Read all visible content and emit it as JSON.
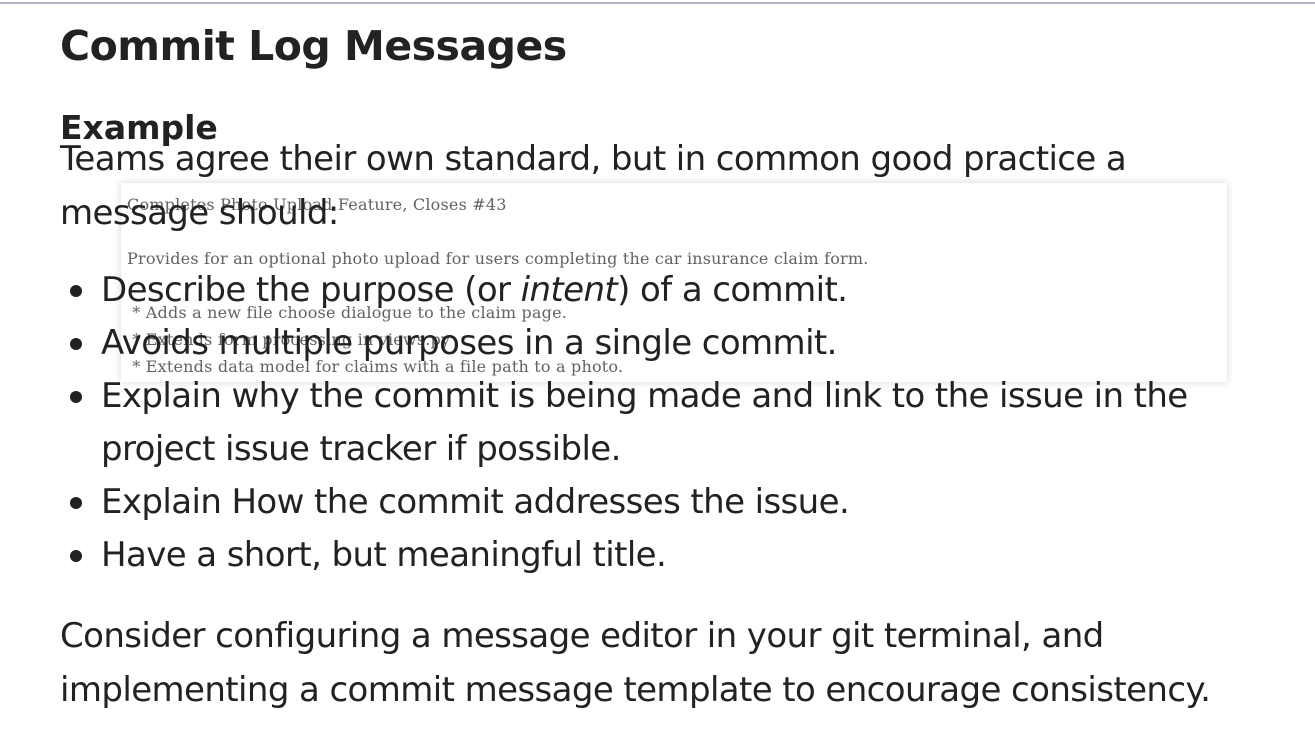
{
  "title": "Commit Log Messages",
  "example_heading": "Example",
  "intro": "Teams agree their own standard, but in common good practice a message should:",
  "code_sample": {
    "line1": "Completes Photo Upload Feature, Closes #43",
    "line2": "",
    "line3": "Provides for an optional photo upload for users completing the car insurance claim form.",
    "line4": "",
    "line5": " * Adds a new file choose dialogue to the claim page.",
    "line6": " * Extends form processing in views.py",
    "line7": " * Extends data model for claims with a file path to a photo."
  },
  "points": [
    {
      "before": "Describe the purpose (or ",
      "em": "intent",
      "after": ") of a commit."
    },
    {
      "before": "Avoids multiple purposes in a single commit.",
      "em": "",
      "after": ""
    },
    {
      "before": "Explain why the commit is being made and link to the issue in the project issue tracker if possible.",
      "em": "",
      "after": ""
    },
    {
      "before": "Explain How the commit addresses the issue.",
      "em": "",
      "after": ""
    },
    {
      "before": "Have a short, but meaningful title.",
      "em": "",
      "after": ""
    }
  ],
  "outro": "Consider configuring a message editor in your git terminal, and implementing a commit message template to encourage consistency."
}
